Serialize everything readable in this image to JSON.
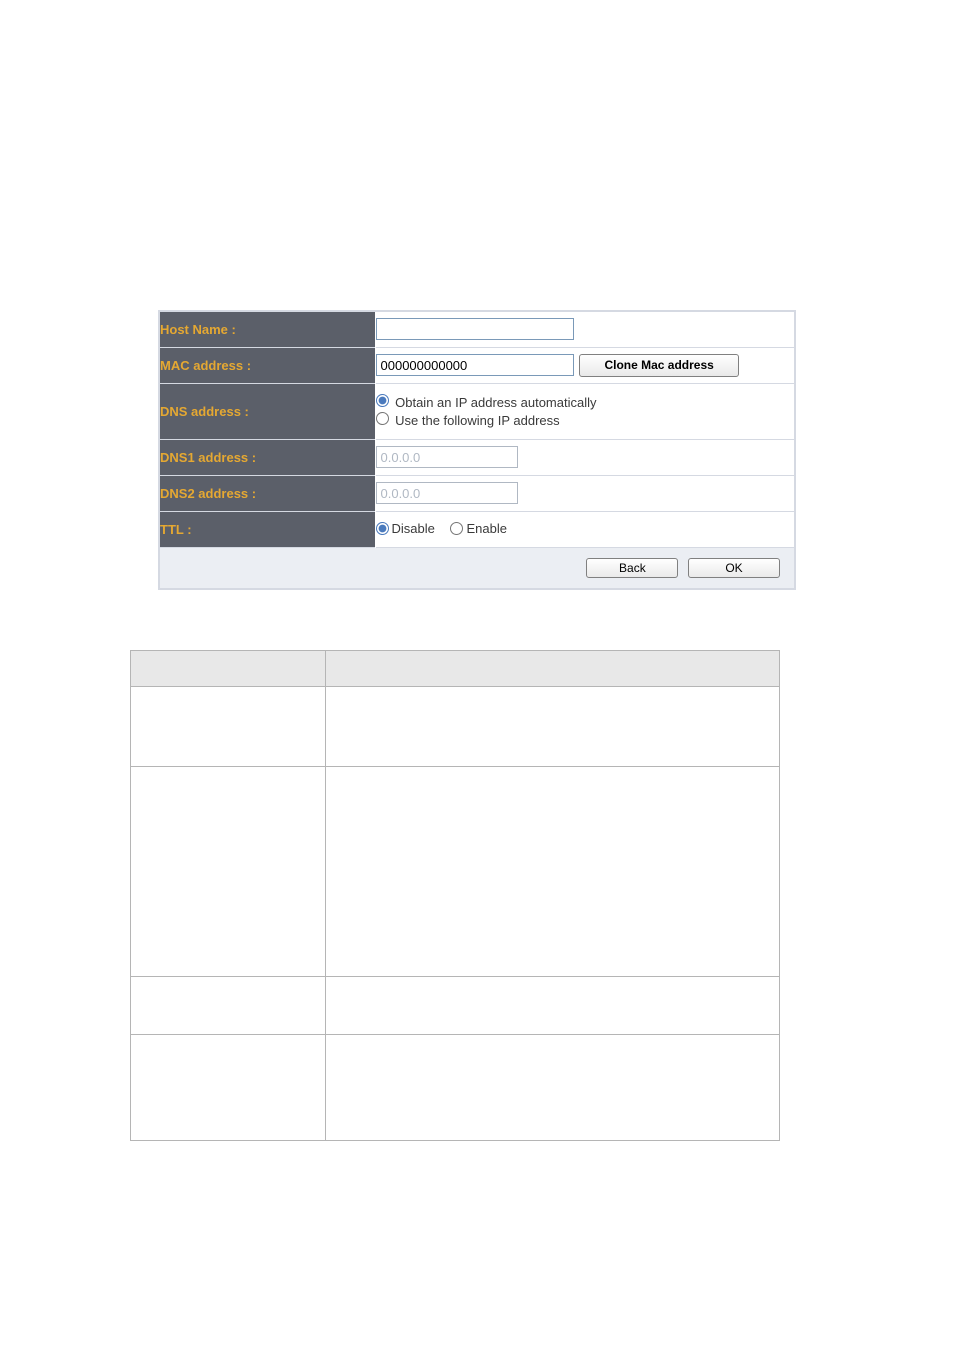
{
  "config": {
    "rows": {
      "host_name": {
        "label": "Host Name :",
        "value": ""
      },
      "mac_address": {
        "label": "MAC address :",
        "value": "000000000000",
        "clone_button": "Clone Mac address"
      },
      "dns_address": {
        "label": "DNS address :",
        "auto_label": "Obtain an IP address automatically",
        "manual_label": "Use the following IP address"
      },
      "dns1": {
        "label": "DNS1 address :",
        "value": "0.0.0.0"
      },
      "dns2": {
        "label": "DNS2 address :",
        "value": "0.0.0.0"
      },
      "ttl": {
        "label": "TTL :",
        "disable_label": "Disable",
        "enable_label": "Enable"
      }
    },
    "footer": {
      "back": "Back",
      "ok": "OK"
    }
  },
  "desc": {
    "rows": [
      {
        "param": "",
        "desc": ""
      },
      {
        "param": "",
        "desc": ""
      },
      {
        "param": "",
        "desc": ""
      },
      {
        "param": "",
        "desc": ""
      }
    ]
  }
}
